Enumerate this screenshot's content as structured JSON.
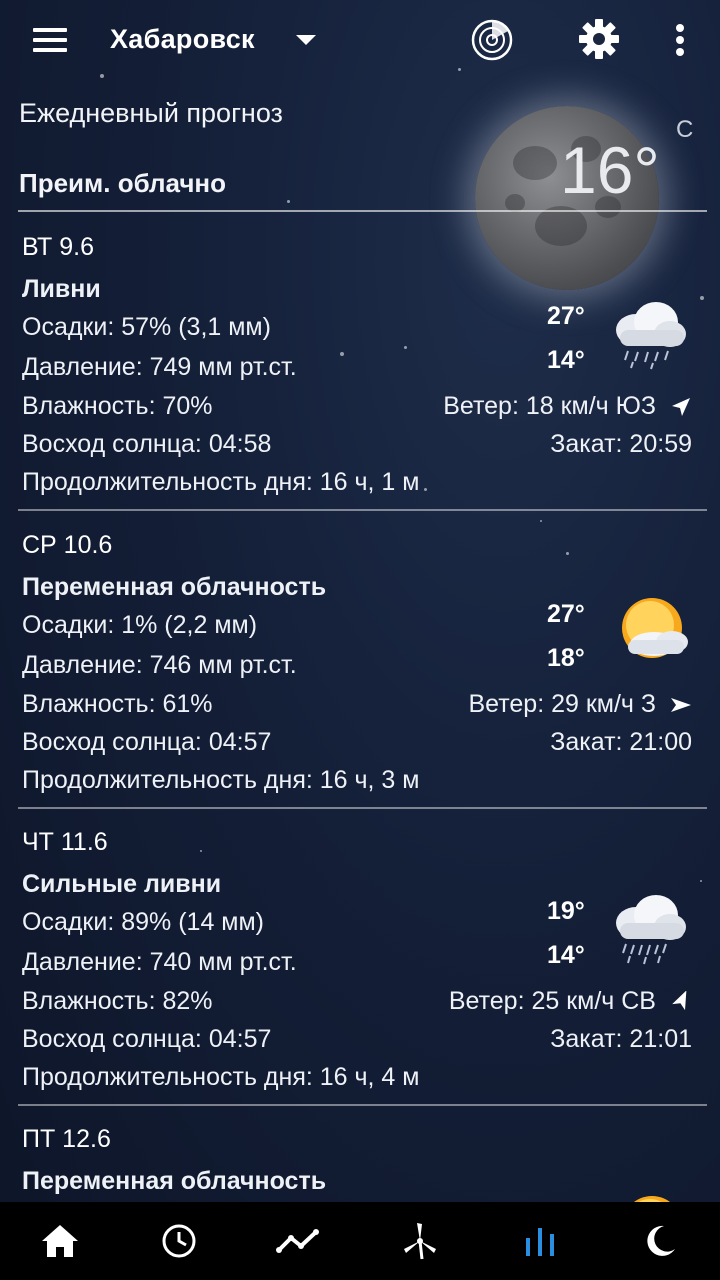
{
  "header": {
    "city": "Хабаровск",
    "section_title": "Ежедневный прогноз",
    "current_condition": "Преим. облачно",
    "current_temp": "16°",
    "temp_unit": "C"
  },
  "icons": {
    "menu": "hamburger-menu-icon",
    "dropdown": "caret-down-icon",
    "radar": "radar-icon",
    "settings": "gear-icon",
    "more": "more-vert-icon"
  },
  "days": [
    {
      "date": "ВТ 9.6",
      "condition": "Ливни",
      "precip": "Осадки: 57% (3,1 мм)",
      "pressure": "Давление: 749 мм рт.ст.",
      "humidity": "Влажность: 70%",
      "wind": "Ветер: 18 км/ч ЮЗ",
      "sunrise": "Восход солнца: 04:58",
      "sunset": "Закат: 20:59",
      "daylength": "Продолжительность дня: 16 ч, 1 м",
      "tmax": "27°",
      "tmin": "14°",
      "icon": "rain-cloud-icon"
    },
    {
      "date": "СР 10.6",
      "condition": "Переменная облачность",
      "precip": "Осадки: 1% (2,2 мм)",
      "pressure": "Давление: 746 мм рт.ст.",
      "humidity": "Влажность: 61%",
      "wind": "Ветер: 29 км/ч З",
      "sunrise": "Восход солнца: 04:57",
      "sunset": "Закат: 21:00",
      "daylength": "Продолжительность дня: 16 ч, 3 м",
      "tmax": "27°",
      "tmin": "18°",
      "icon": "partly-cloudy-icon"
    },
    {
      "date": "ЧТ 11.6",
      "condition": "Сильные ливни",
      "precip": "Осадки: 89% (14 мм)",
      "pressure": "Давление: 740 мм рт.ст.",
      "humidity": "Влажность: 82%",
      "wind": "Ветер: 25 км/ч СВ",
      "sunrise": "Восход солнца: 04:57",
      "sunset": "Закат: 21:01",
      "daylength": "Продолжительность дня: 16 ч, 4 м",
      "tmax": "19°",
      "tmin": "14°",
      "icon": "heavy-rain-cloud-icon"
    },
    {
      "date": "ПТ 12.6",
      "condition": "Переменная облачность"
    }
  ],
  "bottom_nav": [
    {
      "name": "home-icon",
      "active": false
    },
    {
      "name": "clock-icon",
      "active": false
    },
    {
      "name": "chart-line-icon",
      "active": false
    },
    {
      "name": "wind-turbine-icon",
      "active": false
    },
    {
      "name": "bar-chart-icon",
      "active": true
    },
    {
      "name": "moon-icon",
      "active": false
    }
  ],
  "colors": {
    "accent": "#2a8fe0",
    "nav_bg": "#000000",
    "text": "#ffffff"
  }
}
